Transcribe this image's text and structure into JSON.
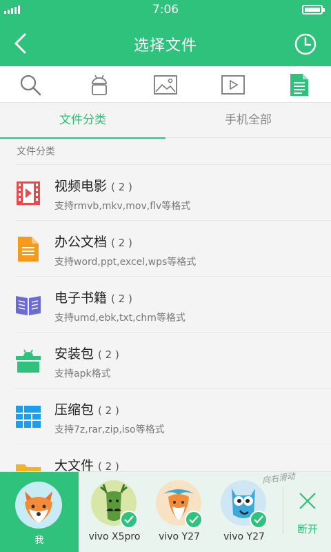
{
  "status": {
    "time": "7:06"
  },
  "header": {
    "title": "选择文件"
  },
  "icon_bar": {
    "items": [
      "search-icon",
      "android-icon",
      "image-icon",
      "video-icon",
      "document-icon"
    ],
    "active": "document-icon"
  },
  "tabs": [
    {
      "label": "文件分类",
      "active": true
    },
    {
      "label": "手机全部",
      "active": false
    }
  ],
  "section_label": "文件分类",
  "categories": [
    {
      "name": "视频电影",
      "count": "( 2 )",
      "desc": "支持rmvb,mkv,mov,flv等格式",
      "icon": "video-file-icon"
    },
    {
      "name": "办公文档",
      "count": "( 2 )",
      "desc": "支持word,ppt,excel,wps等格式",
      "icon": "document-file-icon"
    },
    {
      "name": "电子书籍",
      "count": "( 2 )",
      "desc": "支持umd,ebk,txt,chm等格式",
      "icon": "ebook-icon"
    },
    {
      "name": "安装包",
      "count": "( 2 )",
      "desc": "支持apk格式",
      "icon": "apk-icon"
    },
    {
      "name": "压缩包",
      "count": "( 2 )",
      "desc": "支持7z,rar,zip,iso等格式",
      "icon": "archive-icon"
    },
    {
      "name": "大文件",
      "count": "( 2 )",
      "desc": "",
      "icon": "folder-icon"
    }
  ],
  "bottom": {
    "me_label": "我",
    "devices": [
      {
        "name": "vivo X5pro",
        "avatar": "deer-avatar",
        "connected": true
      },
      {
        "name": "vivo Y27",
        "avatar": "fox-avatar",
        "connected": true
      },
      {
        "name": "vivo Y27",
        "avatar": "owl-avatar",
        "connected": true
      }
    ],
    "swipe_hint": "向右滑动",
    "disconnect_label": "断开"
  },
  "colors": {
    "accent": "#2fc27c",
    "video": "#e84b4b",
    "document": "#f59a1b",
    "ebook": "#6b6bd6",
    "apk": "#2fc27c",
    "archive": "#1a9ff0",
    "folder": "#f5b224"
  }
}
